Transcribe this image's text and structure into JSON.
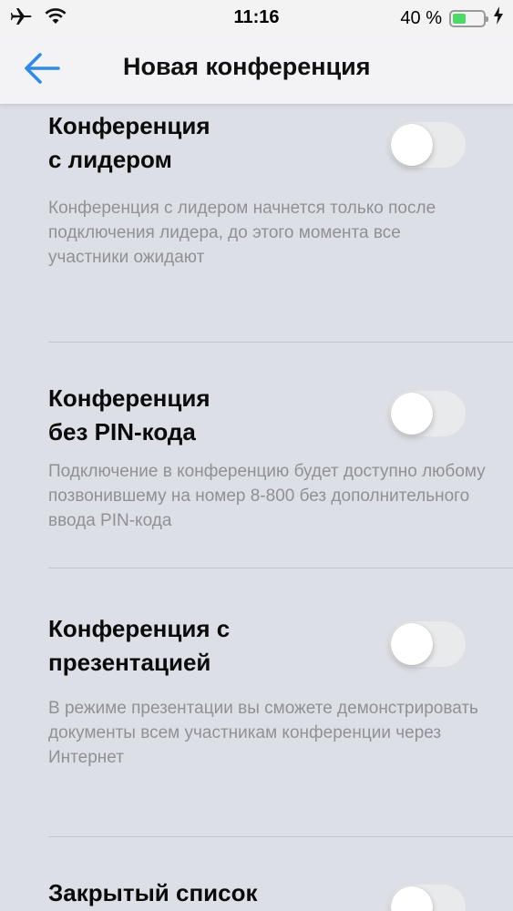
{
  "status_bar": {
    "time": "11:16",
    "battery_percent": "40 %",
    "battery_level": 0.4,
    "icons": [
      "airplane-icon",
      "wifi-icon",
      "battery-icon",
      "charging-bolt-icon"
    ]
  },
  "nav": {
    "title": "Новая конференция",
    "back_icon": "back-arrow-icon"
  },
  "colors": {
    "accent": "#2f8ae5",
    "battery_fill": "#4cd964",
    "background": "#dcdfe5"
  },
  "settings": [
    {
      "title_line1": "Конференция",
      "title_line2": "с лидером",
      "description": "Конференция с лидером начнется только после подключения лидера, до этого момента все участники ожидают",
      "enabled": false
    },
    {
      "title_line1": "Конференция",
      "title_line2": "без PIN-кода",
      "description": "Подключение в конференцию будет доступно любому позвонившему на номер 8-800 без дополнительного ввода PIN-кода",
      "enabled": false
    },
    {
      "title_line1": "Конференция с",
      "title_line2": "презентацией",
      "description": "В режиме презентации вы сможете демонстрировать документы всем участникам конференции через Интернет",
      "enabled": false
    },
    {
      "title_line1": "Закрытый список",
      "title_line2": "",
      "description": "",
      "enabled": false
    }
  ]
}
